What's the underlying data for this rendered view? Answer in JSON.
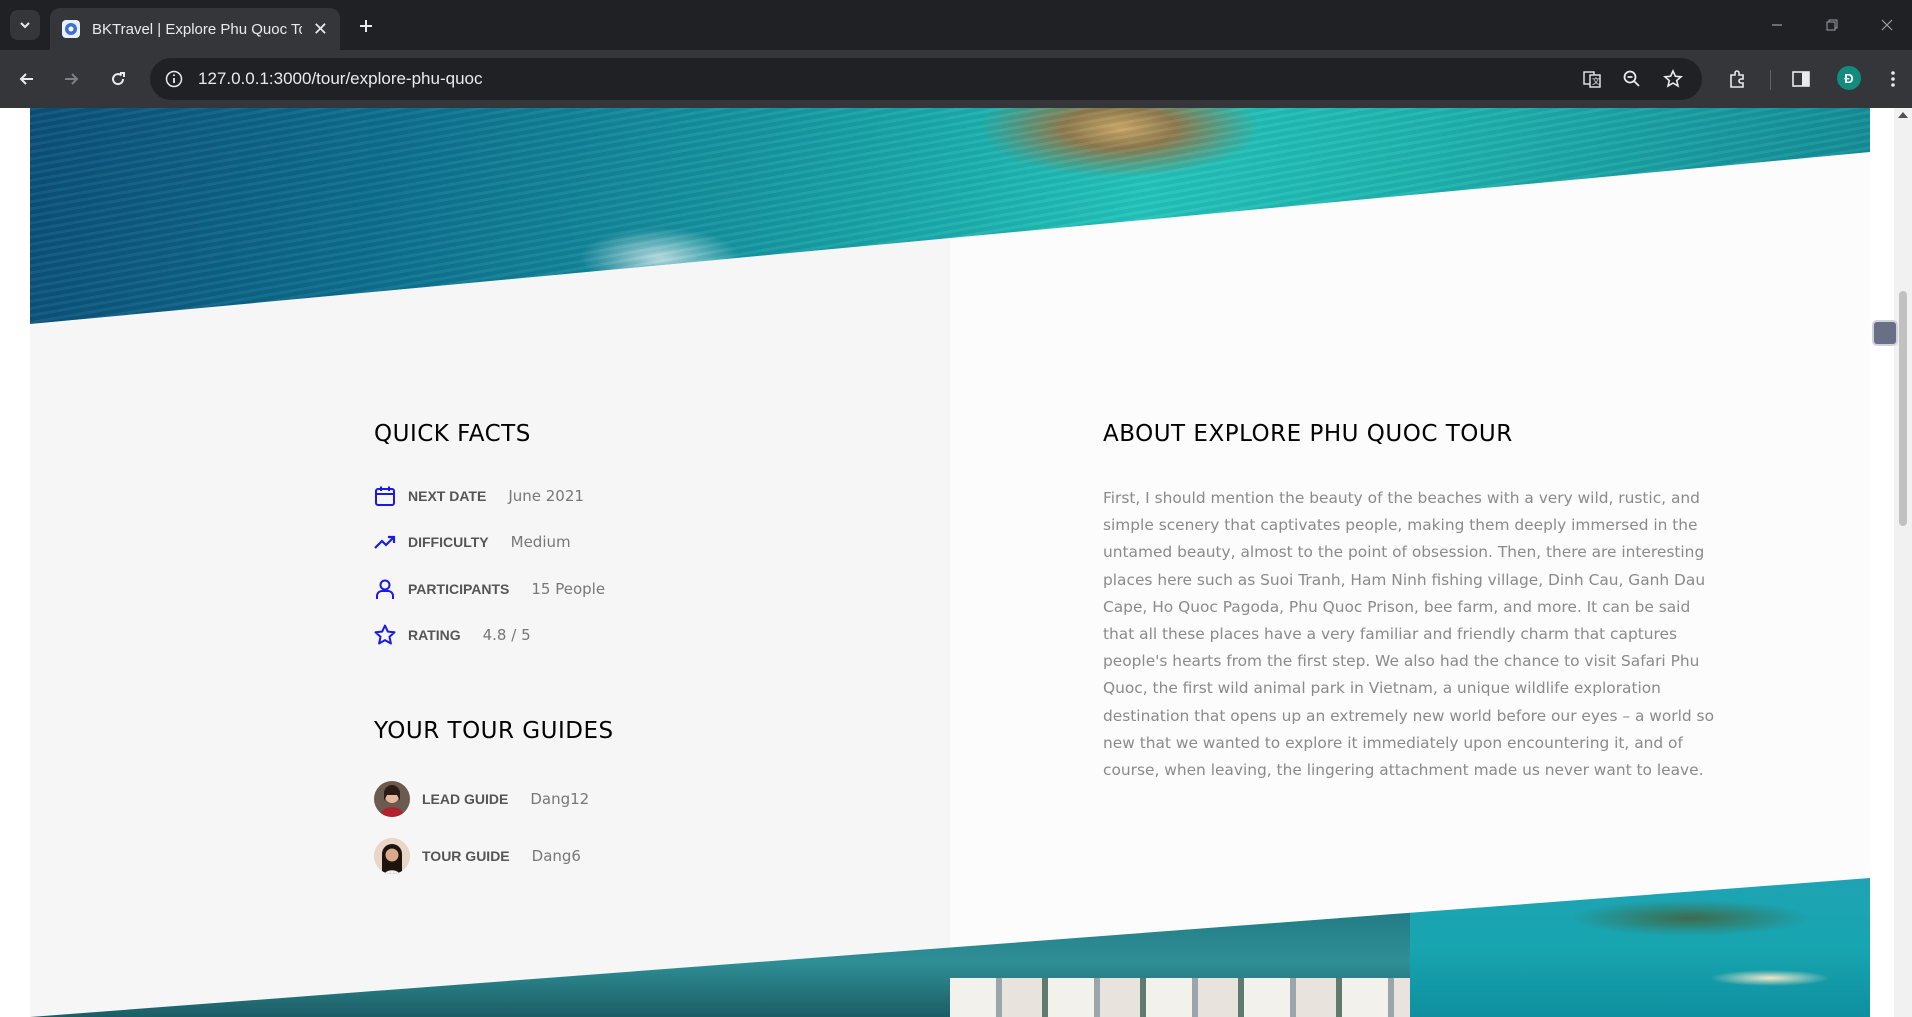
{
  "browser": {
    "tab_title": "BKTravel | Explore Phu Quoc Tour",
    "url": "127.0.0.1:3000/tour/explore-phu-quoc",
    "profile_initial": "Đ"
  },
  "quick_facts": {
    "heading": "Quick facts",
    "items": [
      {
        "icon": "calendar-icon",
        "label": "Next date",
        "value": "June 2021"
      },
      {
        "icon": "trending-up-icon",
        "label": "Difficulty",
        "value": "Medium"
      },
      {
        "icon": "user-icon",
        "label": "Participants",
        "value": "15 People"
      },
      {
        "icon": "star-icon",
        "label": "Rating",
        "value": "4.8 / 5"
      }
    ]
  },
  "tour_guides": {
    "heading": "Your tour guides",
    "items": [
      {
        "label": "Lead guide",
        "value": "Dang12"
      },
      {
        "label": "Tour guide",
        "value": "Dang6"
      }
    ]
  },
  "about": {
    "heading": "About Explore Phu Quoc tour",
    "text": "First, I should mention the beauty of the beaches with a very wild, rustic, and simple scenery that captivates people, making them deeply immersed in the untamed beauty, almost to the point of obsession. Then, there are interesting places here such as Suoi Tranh, Ham Ninh fishing village, Dinh Cau, Ganh Dau Cape, Ho Quoc Pagoda, Phu Quoc Prison, bee farm, and more. It can be said that all these places have a very familiar and friendly charm that captures people's hearts from the first step. We also had the chance to visit Safari Phu Quoc, the first wild animal park in Vietnam, a unique wildlife exploration destination that opens up an extremely new world before our eyes – a world so new that we wanted to explore it immediately upon encountering it, and of course, when leaving, the lingering attachment made us never want to leave."
  },
  "colors": {
    "accent": "#1a1ae6",
    "chrome_dark": "#202124",
    "chrome_toolbar": "#35363a"
  }
}
